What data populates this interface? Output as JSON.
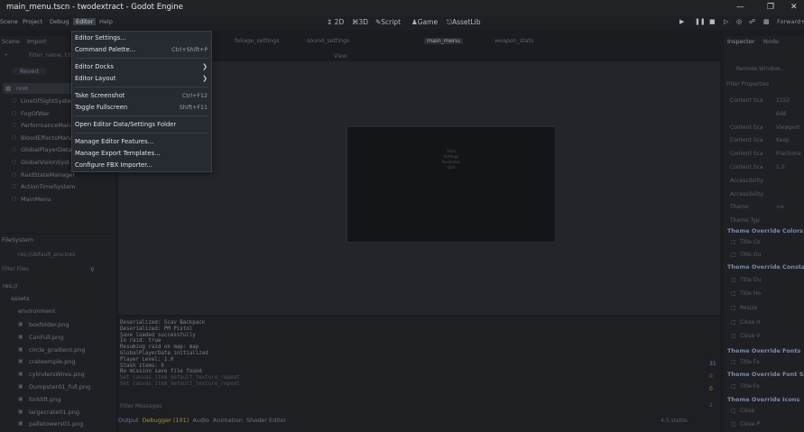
{
  "window": {
    "title": "main_menu.tscn - twodextract - Godot Engine",
    "minimize_icon": "minimize-icon",
    "maximize_icon": "maximize-icon",
    "close_icon": "close-icon"
  },
  "menubar": {
    "items": [
      "Scene",
      "Project",
      "Debug",
      "Editor",
      "Help"
    ],
    "workspaces": [
      "2D",
      "3D",
      "Script",
      "Game",
      "AssetLib"
    ],
    "right_label": "Forward+"
  },
  "editor_menu": {
    "items": [
      {
        "label": "Editor Settings...",
        "shortcut": ""
      },
      {
        "label": "Command Palette...",
        "shortcut": "Ctrl+Shift+P"
      },
      {
        "label": "Editor Docks",
        "shortcut": "",
        "submenu": true
      },
      {
        "label": "Editor Layout",
        "shortcut": "",
        "submenu": true
      },
      {
        "label": "Take Screenshot",
        "shortcut": "Ctrl+F12"
      },
      {
        "label": "Toggle Fullscreen",
        "shortcut": "Shift+F11"
      },
      {
        "label": "Open Editor Data/Settings Folder",
        "shortcut": ""
      },
      {
        "label": "Manage Editor Features...",
        "shortcut": ""
      },
      {
        "label": "Manage Export Templates...",
        "shortcut": ""
      },
      {
        "label": "Configure FBX Importer...",
        "shortcut": ""
      }
    ]
  },
  "scene_dock": {
    "tabs": [
      "Scene",
      "Import"
    ],
    "filter_placeholder": "Filter: name, t:type",
    "revert_label": "Revert",
    "root_label": "root",
    "nodes": [
      "LineOfSightSystem",
      "FogOfWar",
      "PerformanceMana",
      "BloodEffectsMana",
      "GlobalPlayerData",
      "GlobalVisionSyst",
      "RaidStateManager",
      "ActionTimeSystem",
      "MainMenu"
    ]
  },
  "filesystem": {
    "title": "FileSystem",
    "path": "res://default_env.tres",
    "filter_placeholder": "Filter Files",
    "tree": [
      "res://",
      "assets",
      "environment"
    ],
    "files": [
      "boxfolder.png",
      "CanFull.png",
      "circle_gradient.png",
      "crateemple.png",
      "cylindersWires.png",
      "Dumpster01_full.png",
      "forklift.png",
      "largecrate01.png",
      "palletowers01.png"
    ]
  },
  "scene_tabs": [
    "main_menu",
    "foliage_settings",
    "sound_settings",
    "weapon_stats"
  ],
  "viewport": {
    "view_label": "View",
    "game_text": [
      "Start",
      "Settings",
      "Resolution",
      "Quit"
    ]
  },
  "output": {
    "lines": [
      "Deserialized: Scav Backpack",
      "Deserialized: PM Pistol",
      "Save loaded successfully",
      "In raid: true",
      "Resuming raid on map: map",
      "GlobalPlayerData initialized",
      "Player Level: 1.0",
      "Stash items: 0",
      "No mission save file found",
      "Set canvas_item_default_texture_repeat",
      "Set canvas_item_default_texture_repeat"
    ],
    "filter_placeholder": "Filter Messages",
    "bottom_tabs": [
      "Output",
      "Debugger (101)",
      "Audio",
      "Animation",
      "Shader Editor"
    ],
    "version": "4.5.stable",
    "counts": [
      "31",
      "0",
      "0",
      "2"
    ]
  },
  "inspector": {
    "tabs": [
      "Inspector",
      "Node"
    ],
    "object": "Remote Window...",
    "filter_placeholder": "Filter Properties",
    "props": [
      {
        "name": "Content Sca",
        "value": "1152"
      },
      {
        "name": "",
        "value": "648"
      },
      {
        "name": "Content Sca",
        "value": "Viewport"
      },
      {
        "name": "Content Sca",
        "value": "Keep"
      },
      {
        "name": "Content Sca",
        "value": "Fractiona"
      },
      {
        "name": "Content Sca",
        "value": "1.0"
      },
      {
        "name": "Accessibility",
        "value": ""
      },
      {
        "name": "Accessibility",
        "value": ""
      },
      {
        "name": "Theme",
        "value": "<e"
      },
      {
        "name": "Theme Typ",
        "value": ""
      }
    ],
    "sections": [
      "Theme Override Colors",
      "Theme Override Constants",
      "Theme Override Fonts",
      "Theme Override Font Sizes",
      "Theme Override Icons"
    ],
    "override_rows": [
      "Title Co",
      "Title Ou",
      "Title Ou",
      "Title Ho",
      "Resize",
      "Close H",
      "Close V",
      "Title Fo",
      "Title Fo",
      "Close",
      "Close P"
    ]
  }
}
